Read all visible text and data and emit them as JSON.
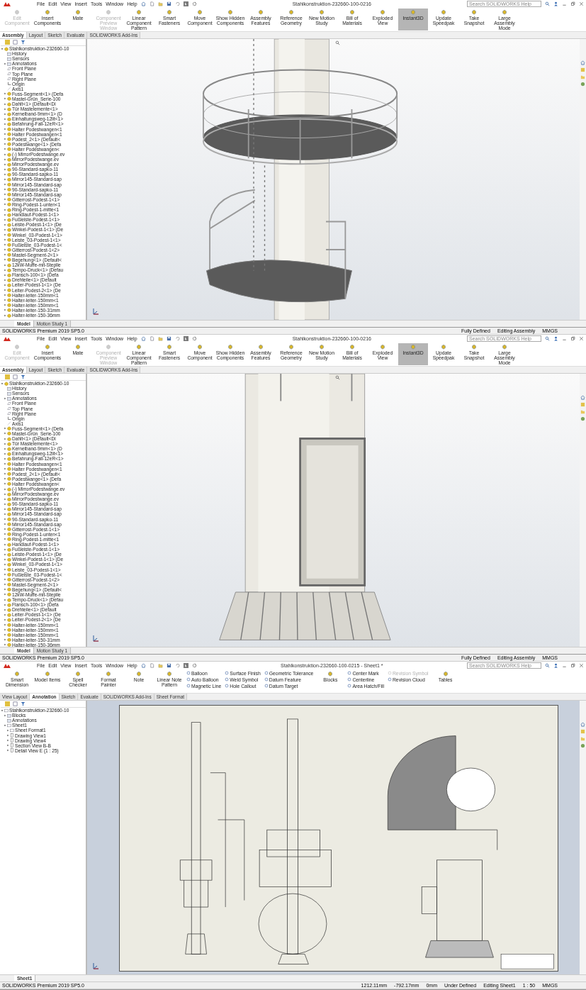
{
  "windows": [
    {
      "kind": "assembly",
      "menu": [
        "File",
        "Edit",
        "View",
        "Insert",
        "Tools",
        "Window",
        "Help"
      ],
      "title": "Stahlkonstruktion-232660-100-0216",
      "search": {
        "placeholder": "Search SOLIDWORKS Help"
      },
      "commands": [
        {
          "kind": "large",
          "label": "Edit Component",
          "disabled": true,
          "selected": false
        },
        {
          "kind": "large",
          "label": "Insert Components",
          "disabled": false,
          "selected": false
        },
        {
          "kind": "large",
          "label": "Mate",
          "disabled": false,
          "selected": false
        },
        {
          "kind": "large",
          "label": "Component Preview Window",
          "disabled": true,
          "selected": false
        },
        {
          "kind": "large",
          "label": "Linear Component Pattern",
          "disabled": false,
          "selected": false
        },
        {
          "kind": "large",
          "label": "Smart Fasteners",
          "disabled": false,
          "selected": false
        },
        {
          "kind": "large",
          "label": "Move Component",
          "disabled": false,
          "selected": false
        },
        {
          "kind": "large",
          "label": "Show Hidden Components",
          "disabled": false,
          "selected": false
        },
        {
          "kind": "large",
          "label": "Assembly Features",
          "disabled": false,
          "selected": false
        },
        {
          "kind": "large",
          "label": "Reference Geometry",
          "disabled": false,
          "selected": false
        },
        {
          "kind": "large",
          "label": "New Motion Study",
          "disabled": false,
          "selected": false
        },
        {
          "kind": "large",
          "label": "Bill of Materials",
          "disabled": false,
          "selected": false
        },
        {
          "kind": "large",
          "label": "Exploded View",
          "disabled": false,
          "selected": false
        },
        {
          "kind": "large",
          "label": "Instant3D",
          "disabled": false,
          "selected": true
        },
        {
          "kind": "large",
          "label": "Update Speedpak",
          "disabled": false,
          "selected": false
        },
        {
          "kind": "large",
          "label": "Take Snapshot",
          "disabled": false,
          "selected": false
        },
        {
          "kind": "large",
          "label": "Large Assembly Mode",
          "disabled": false,
          "selected": false
        }
      ],
      "tabs": [
        {
          "label": "Assembly",
          "selected": true
        },
        {
          "label": "Layout",
          "selected": false
        },
        {
          "label": "Sketch",
          "selected": false
        },
        {
          "label": "Evaluate",
          "selected": false
        },
        {
          "label": "SOLIDWORKS Add-Ins",
          "selected": false
        }
      ],
      "tree": {
        "label": "Stahlkonstruktion-232660-10",
        "kind": "assembly",
        "expanded": true,
        "children": [
          {
            "label": "History",
            "kind": "folder"
          },
          {
            "label": "Sensors",
            "kind": "folder"
          },
          {
            "label": "Annotations",
            "kind": "folder",
            "expanded": false
          },
          {
            "label": "Front Plane",
            "kind": "plane"
          },
          {
            "label": "Top Plane",
            "kind": "plane"
          },
          {
            "label": "Right Plane",
            "kind": "plane"
          },
          {
            "label": "Origin",
            "kind": "origin"
          },
          {
            "label": "Axis1",
            "kind": "axis"
          },
          {
            "label": "Fuss-Segment<1> (Defa",
            "kind": "part",
            "expanded": false
          },
          {
            "label": "Mastel-Grün_Serie-100",
            "kind": "part",
            "expanded": false
          },
          {
            "label": "Dahlt<1> (Default<Di",
            "kind": "part",
            "expanded": false
          },
          {
            "label": "Tür Mastelemente<1>",
            "kind": "part",
            "expanded": false
          },
          {
            "label": "Kernelband-9mm<1> (D",
            "kind": "part",
            "expanded": false
          },
          {
            "label": "Einhaltungsweg-12lit<1>",
            "kind": "part",
            "expanded": false
          },
          {
            "label": "Befahrung-Fall-12eR<1>",
            "kind": "part",
            "expanded": false
          },
          {
            "label": "Halter Podestwangen<1",
            "kind": "part",
            "expanded": false
          },
          {
            "label": "Halter Podestwangen<1",
            "kind": "part",
            "expanded": false
          },
          {
            "label": "Podest_2<1> (Default<",
            "kind": "part",
            "expanded": false
          },
          {
            "label": "Podestwange<1> (Defa",
            "kind": "part",
            "expanded": false
          },
          {
            "label": "Halter Podestwangen<",
            "kind": "part",
            "expanded": false
          },
          {
            "label": "(-) MirrorPodestwange.ev",
            "kind": "part",
            "expanded": false
          },
          {
            "label": "MirrorPodestwange.ev",
            "kind": "part",
            "expanded": false
          },
          {
            "label": "MirrorPodestwange.ev",
            "kind": "part",
            "expanded": false
          },
          {
            "label": "90-Standard-sapko-11",
            "kind": "part",
            "expanded": false
          },
          {
            "label": "90-Standard-sapko-11",
            "kind": "part",
            "expanded": false
          },
          {
            "label": "Mirror145-Standard-sap",
            "kind": "part",
            "expanded": false
          },
          {
            "label": "Mirror145-Standard-sap",
            "kind": "part",
            "expanded": false
          },
          {
            "label": "90-Standard-sapko-11",
            "kind": "part",
            "expanded": false
          },
          {
            "label": "Mirror145-Standard-sap",
            "kind": "part",
            "expanded": false
          },
          {
            "label": "Gitterrost-Podest-1<1>",
            "kind": "part",
            "expanded": false
          },
          {
            "label": "Ring-Podest-1-unten<1",
            "kind": "part",
            "expanded": false
          },
          {
            "label": "Ring-Podest-1-mitte<1",
            "kind": "part",
            "expanded": false
          },
          {
            "label": "Handlauf-Podest-1<1>",
            "kind": "part",
            "expanded": false
          },
          {
            "label": "Fußleiste-Podest-1<1>",
            "kind": "part",
            "expanded": false
          },
          {
            "label": "Leiste-Podest-1<1> (De",
            "kind": "part",
            "expanded": false
          },
          {
            "label": "Winkel-Podest-1<1> (De",
            "kind": "part",
            "expanded": false
          },
          {
            "label": "Winkel_03-Podest-1<1>",
            "kind": "part",
            "expanded": false
          },
          {
            "label": "Leiste_03-Podest-1<1>",
            "kind": "part",
            "expanded": false
          },
          {
            "label": "Fußleiste_03-Podest-1<",
            "kind": "part",
            "expanded": false
          },
          {
            "label": "Gitterrost-Podest-1<2>",
            "kind": "part",
            "expanded": false
          },
          {
            "label": "Mastel-Segment-2<1>",
            "kind": "part",
            "expanded": false
          },
          {
            "label": "Begehung<1> (Default<",
            "kind": "part",
            "expanded": false
          },
          {
            "label": "12kW-Muffe-mit-Steplle",
            "kind": "part",
            "expanded": false
          },
          {
            "label": "Tempo-Druck<1> (Defau",
            "kind": "part",
            "expanded": false
          },
          {
            "label": "Flansch-100<1> (Defa",
            "kind": "part",
            "expanded": false
          },
          {
            "label": "Drehteile<1> (Default",
            "kind": "part",
            "expanded": false
          },
          {
            "label": "Leiter-Podest-1<1> (De",
            "kind": "part",
            "expanded": false
          },
          {
            "label": "Leiter-Podest-2<1> (De",
            "kind": "part",
            "expanded": false
          },
          {
            "label": "Halter-leiter-150mm<1",
            "kind": "part",
            "expanded": false
          },
          {
            "label": "Halter-leiter-150mm<1",
            "kind": "part",
            "expanded": false
          },
          {
            "label": "Halter-leiter-150mm<1",
            "kind": "part",
            "expanded": false
          },
          {
            "label": "Halter-leiter-150-31mm",
            "kind": "part",
            "expanded": false
          },
          {
            "label": "Halter-leiter-150-36mm",
            "kind": "part",
            "expanded": false
          }
        ]
      },
      "bottom_tabs": [
        {
          "label": "Model",
          "selected": true
        },
        {
          "label": "Motion Study 1",
          "selected": false
        }
      ]
    },
    {
      "kind": "assembly",
      "status": {
        "product": "SOLIDWORKS Premium 2019 SP5.0",
        "items": [
          "Fully Defined",
          "Editing Assembly",
          "MMGS"
        ]
      },
      "menu": [
        "File",
        "Edit",
        "View",
        "Insert",
        "Tools",
        "Window",
        "Help"
      ],
      "title": "Stahlkonstruktion-232660-100-0216",
      "search": {
        "placeholder": "Search SOLIDWORKS Help"
      },
      "commands": [
        {
          "kind": "large",
          "label": "Edit Component",
          "disabled": true,
          "selected": false
        },
        {
          "kind": "large",
          "label": "Insert Components",
          "disabled": false,
          "selected": false
        },
        {
          "kind": "large",
          "label": "Mate",
          "disabled": false,
          "selected": false
        },
        {
          "kind": "large",
          "label": "Component Preview Window",
          "disabled": true,
          "selected": false
        },
        {
          "kind": "large",
          "label": "Linear Component Pattern",
          "disabled": false,
          "selected": false
        },
        {
          "kind": "large",
          "label": "Smart Fasteners",
          "disabled": false,
          "selected": false
        },
        {
          "kind": "large",
          "label": "Move Component",
          "disabled": false,
          "selected": false
        },
        {
          "kind": "large",
          "label": "Show Hidden Components",
          "disabled": false,
          "selected": false
        },
        {
          "kind": "large",
          "label": "Assembly Features",
          "disabled": false,
          "selected": false
        },
        {
          "kind": "large",
          "label": "Reference Geometry",
          "disabled": false,
          "selected": false
        },
        {
          "kind": "large",
          "label": "New Motion Study",
          "disabled": false,
          "selected": false
        },
        {
          "kind": "large",
          "label": "Bill of Materials",
          "disabled": false,
          "selected": false
        },
        {
          "kind": "large",
          "label": "Exploded View",
          "disabled": false,
          "selected": false
        },
        {
          "kind": "large",
          "label": "Instant3D",
          "disabled": false,
          "selected": true
        },
        {
          "kind": "large",
          "label": "Update Speedpak",
          "disabled": false,
          "selected": false
        },
        {
          "kind": "large",
          "label": "Take Snapshot",
          "disabled": false,
          "selected": false
        },
        {
          "kind": "large",
          "label": "Large Assembly Mode",
          "disabled": false,
          "selected": false
        }
      ],
      "tabs": [
        {
          "label": "Assembly",
          "selected": true
        },
        {
          "label": "Layout",
          "selected": false
        },
        {
          "label": "Sketch",
          "selected": false
        },
        {
          "label": "Evaluate",
          "selected": false
        },
        {
          "label": "SOLIDWORKS Add-Ins",
          "selected": false
        }
      ],
      "tree": {
        "label": "Stahlkonstruktion-232660-10",
        "kind": "assembly",
        "expanded": true,
        "children": [
          {
            "label": "History",
            "kind": "folder"
          },
          {
            "label": "Sensors",
            "kind": "folder"
          },
          {
            "label": "Annotations",
            "kind": "folder",
            "expanded": false
          },
          {
            "label": "Front Plane",
            "kind": "plane"
          },
          {
            "label": "Top Plane",
            "kind": "plane"
          },
          {
            "label": "Right Plane",
            "kind": "plane"
          },
          {
            "label": "Origin",
            "kind": "origin"
          },
          {
            "label": "Axis1",
            "kind": "axis"
          },
          {
            "label": "Fuss-Segment<1> (Defa",
            "kind": "part",
            "expanded": false
          },
          {
            "label": "Mastel-Grün_Serie-100",
            "kind": "part",
            "expanded": false
          },
          {
            "label": "Dahlt<1> (Default<Di",
            "kind": "part",
            "expanded": false
          },
          {
            "label": "Tür Mastelemente<1>",
            "kind": "part",
            "expanded": false
          },
          {
            "label": "Kernelband-9mm<1> (D",
            "kind": "part",
            "expanded": false
          },
          {
            "label": "Einhaltungsweg-12lit<1>",
            "kind": "part",
            "expanded": false
          },
          {
            "label": "Befahrung-Fall-12eR<1>",
            "kind": "part",
            "expanded": false
          },
          {
            "label": "Halter Podestwangen<1",
            "kind": "part",
            "expanded": false
          },
          {
            "label": "Halter Podestwangen<1",
            "kind": "part",
            "expanded": false
          },
          {
            "label": "Podest_2<1> (Default<",
            "kind": "part",
            "expanded": false
          },
          {
            "label": "Podestwange<1> (Defa",
            "kind": "part",
            "expanded": false
          },
          {
            "label": "Halter Podestwangen<",
            "kind": "part",
            "expanded": false
          },
          {
            "label": "(-) MirrorPodestwange.ev",
            "kind": "part",
            "expanded": false
          },
          {
            "label": "MirrorPodestwange.ev",
            "kind": "part",
            "expanded": false
          },
          {
            "label": "MirrorPodestwange.ev",
            "kind": "part",
            "expanded": false
          },
          {
            "label": "90-Standard-sapko-11",
            "kind": "part",
            "expanded": false
          },
          {
            "label": "Mirror145-Standard-sap",
            "kind": "part",
            "expanded": false
          },
          {
            "label": "Mirror145-Standard-sap",
            "kind": "part",
            "expanded": false
          },
          {
            "label": "90-Standard-sapko-11",
            "kind": "part",
            "expanded": false
          },
          {
            "label": "Mirror145-Standard-sap",
            "kind": "part",
            "expanded": false
          },
          {
            "label": "Gitterrost-Podest-1<1>",
            "kind": "part",
            "expanded": false
          },
          {
            "label": "Ring-Podest-1-unten<1",
            "kind": "part",
            "expanded": false
          },
          {
            "label": "Ring-Podest-1-mitte<1",
            "kind": "part",
            "expanded": false
          },
          {
            "label": "Handlauf-Podest-1<1>",
            "kind": "part",
            "expanded": false
          },
          {
            "label": "Fußleiste-Podest-1<1>",
            "kind": "part",
            "expanded": false
          },
          {
            "label": "Leiste-Podest-1<1> (De",
            "kind": "part",
            "expanded": false
          },
          {
            "label": "Winkel-Podest-1<1> (De",
            "kind": "part",
            "expanded": false
          },
          {
            "label": "Winkel_03-Podest-1<1>",
            "kind": "part",
            "expanded": false
          },
          {
            "label": "Leiste_03-Podest-1<1>",
            "kind": "part",
            "expanded": false
          },
          {
            "label": "Fußleiste_03-Podest-1<",
            "kind": "part",
            "expanded": false
          },
          {
            "label": "Gitterrost-Podest-1<2>",
            "kind": "part",
            "expanded": false
          },
          {
            "label": "Mastel-Segment-2<1>",
            "kind": "part",
            "expanded": false
          },
          {
            "label": "Begehung<1> (Default<",
            "kind": "part",
            "expanded": false
          },
          {
            "label": "12kW-Muffe-mit-Steplle",
            "kind": "part",
            "expanded": false
          },
          {
            "label": "Tempo-Druck<1> (Defau",
            "kind": "part",
            "expanded": false
          },
          {
            "label": "Flansch-100<1> (Defa",
            "kind": "part",
            "expanded": false
          },
          {
            "label": "Drehteile<1> (Default",
            "kind": "part",
            "expanded": false
          },
          {
            "label": "Leiter-Podest-1<1> (De",
            "kind": "part",
            "expanded": false
          },
          {
            "label": "Leiter-Podest-2<1> (De",
            "kind": "part",
            "expanded": false
          },
          {
            "label": "Halter-leiter-150mm<1",
            "kind": "part",
            "expanded": false
          },
          {
            "label": "Halter-leiter-150mm<1",
            "kind": "part",
            "expanded": false
          },
          {
            "label": "Halter-leiter-150mm<1",
            "kind": "part",
            "expanded": false
          },
          {
            "label": "Halter-leiter-150-31mm",
            "kind": "part",
            "expanded": false
          },
          {
            "label": "Halter-leiter-150-36mm",
            "kind": "part",
            "expanded": false
          }
        ]
      },
      "bottom_tabs": [
        {
          "label": "Model",
          "selected": true
        },
        {
          "label": "Motion Study 1",
          "selected": false
        }
      ]
    },
    {
      "kind": "drawing",
      "status": {
        "product": "SOLIDWORKS Premium 2019 SP5.0",
        "items": [
          "Fully Defined",
          "Editing Assembly",
          "MMGS"
        ]
      },
      "menu": [
        "File",
        "Edit",
        "View",
        "Insert",
        "Tools",
        "Window",
        "Help"
      ],
      "title": "Stahlkonstruktion-232660-100-0215 - Sheet1 *",
      "search": {
        "placeholder": "Search SOLIDWORKS Help"
      },
      "commands": [
        {
          "kind": "large",
          "label": "Smart Dimension",
          "disabled": false,
          "selected": false
        },
        {
          "kind": "large",
          "label": "Model Items",
          "disabled": false,
          "selected": false
        },
        {
          "kind": "large",
          "label": "Spell Checker",
          "disabled": false,
          "selected": false
        },
        {
          "kind": "large",
          "label": "Format Painter",
          "disabled": false,
          "selected": false
        },
        {
          "kind": "large",
          "label": "Note",
          "disabled": false,
          "selected": false
        },
        {
          "kind": "large",
          "label": "Linear Note Pattern",
          "disabled": false,
          "selected": false
        },
        {
          "kind": "stack",
          "items": [
            {
              "label": "Balloon",
              "disabled": false
            },
            {
              "label": "Auto Balloon",
              "disabled": false
            },
            {
              "label": "Magnetic Line",
              "disabled": false
            }
          ]
        },
        {
          "kind": "stack",
          "items": [
            {
              "label": "Surface Finish",
              "disabled": false
            },
            {
              "label": "Weld Symbol",
              "disabled": false
            },
            {
              "label": "Hole Callout",
              "disabled": false
            }
          ]
        },
        {
          "kind": "stack",
          "items": [
            {
              "label": "Geometric Tolerance",
              "disabled": false
            },
            {
              "label": "Datum Feature",
              "disabled": false
            },
            {
              "label": "Datum Target",
              "disabled": false
            }
          ]
        },
        {
          "kind": "large",
          "label": "Blocks",
          "disabled": false,
          "selected": false
        },
        {
          "kind": "stack",
          "items": [
            {
              "label": "Center Mark",
              "disabled": false
            },
            {
              "label": "Centerline",
              "disabled": false
            },
            {
              "label": "Area Hatch/Fill",
              "disabled": false
            }
          ]
        },
        {
          "kind": "stack",
          "items": [
            {
              "label": "Revision Symbol",
              "disabled": true
            },
            {
              "label": "Revision Cloud",
              "disabled": false
            }
          ]
        },
        {
          "kind": "large",
          "label": "Tables",
          "disabled": false,
          "selected": false
        }
      ],
      "tabs": [
        {
          "label": "View Layout",
          "selected": false
        },
        {
          "label": "Annotation",
          "selected": true
        },
        {
          "label": "Sketch",
          "selected": false
        },
        {
          "label": "Evaluate",
          "selected": false
        },
        {
          "label": "SOLIDWORKS Add-Ins",
          "selected": false
        },
        {
          "label": "Sheet Format",
          "selected": false
        }
      ],
      "tree": {
        "label": "Stahlkonstruktion-232660-10",
        "kind": "drawing",
        "expanded": true,
        "children": [
          {
            "label": "Blocks",
            "kind": "folder",
            "expanded": false
          },
          {
            "label": "Annotations",
            "kind": "folder"
          },
          {
            "label": "Sheet1",
            "kind": "sheet",
            "expanded": true,
            "children": [
              {
                "label": "Sheet Format1",
                "kind": "sheet",
                "expanded": false
              },
              {
                "label": "Drawing View1",
                "kind": "view",
                "expanded": false
              },
              {
                "label": "Drawing View4",
                "kind": "view",
                "expanded": false
              },
              {
                "label": "Section View B-B",
                "kind": "view",
                "expanded": false
              },
              {
                "label": "Detail View E (1 : 25)",
                "kind": "view",
                "expanded": false
              }
            ]
          }
        ]
      },
      "bottom_tabs": [
        {
          "label": "Sheet1",
          "selected": true
        }
      ],
      "bottom_status": {
        "product": "SOLIDWORKS Premium 2019 SP5.0",
        "items": [
          "1212.11mm",
          "-792.17mm",
          "0mm",
          "Under Defined",
          "Editing Sheet1",
          "1 : 50",
          "MMGS"
        ]
      }
    }
  ]
}
